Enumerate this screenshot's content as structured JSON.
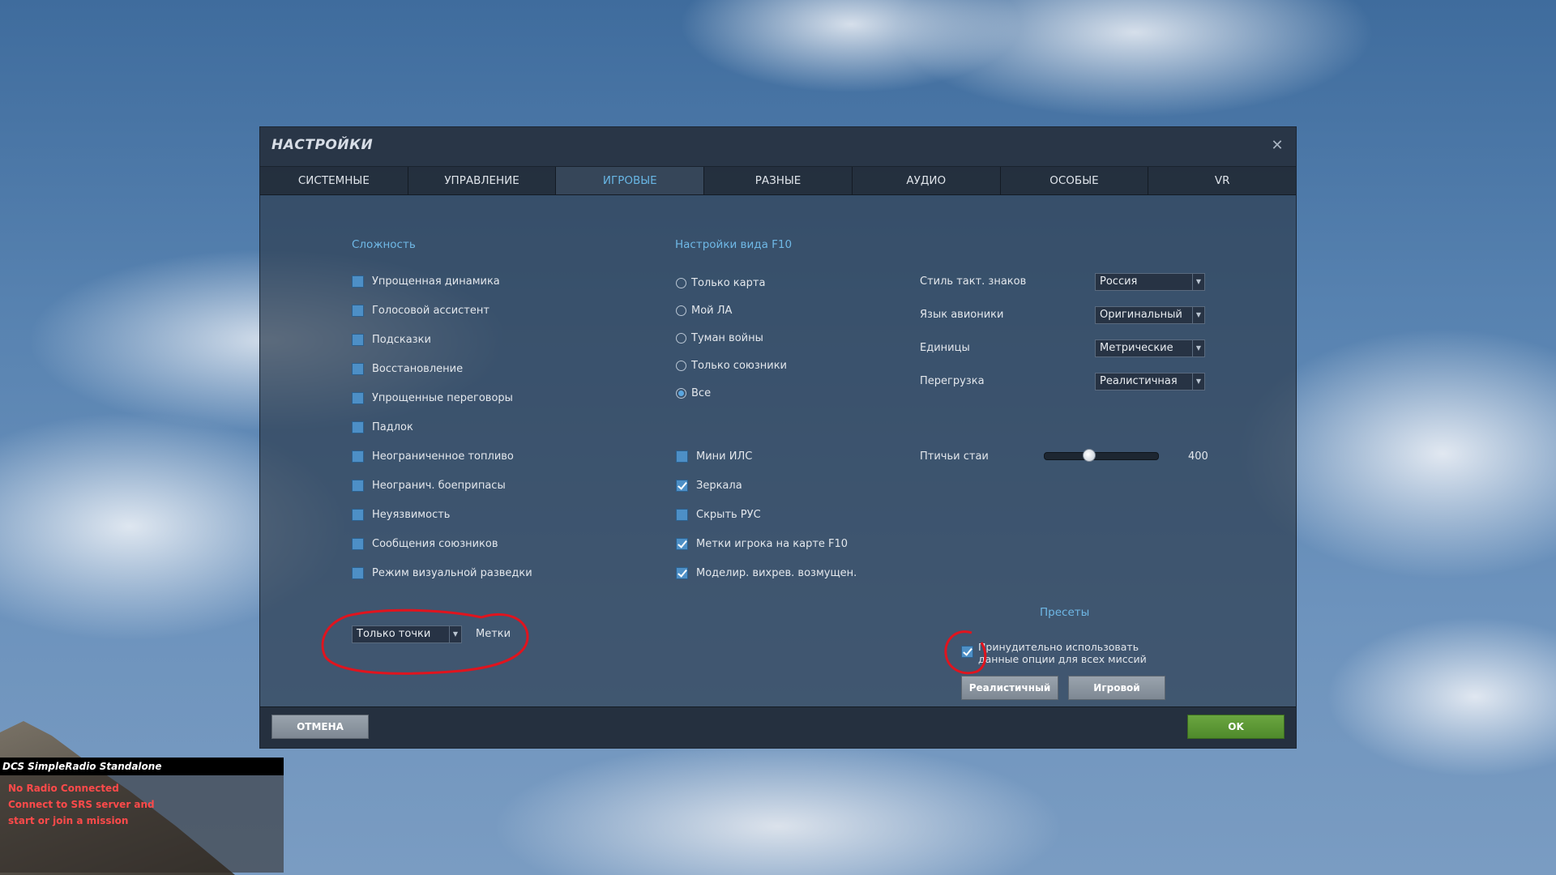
{
  "dialog": {
    "title": "НАСТРОЙКИ",
    "close_symbol": "✕"
  },
  "tabs": [
    {
      "label": "СИСТЕМНЫЕ"
    },
    {
      "label": "УПРАВЛЕНИЕ"
    },
    {
      "label": "ИГРОВЫЕ",
      "active": true
    },
    {
      "label": "РАЗНЫЕ"
    },
    {
      "label": "АУДИО"
    },
    {
      "label": "ОСОБЫЕ"
    },
    {
      "label": "VR"
    }
  ],
  "difficulty": {
    "title": "Сложность",
    "items": [
      {
        "label": "Упрощенная динамика",
        "checked": false
      },
      {
        "label": "Голосовой ассистент",
        "checked": false
      },
      {
        "label": "Подсказки",
        "checked": false
      },
      {
        "label": "Восстановление",
        "checked": false
      },
      {
        "label": "Упрощенные переговоры",
        "checked": false
      },
      {
        "label": "Падлок",
        "checked": false
      },
      {
        "label": "Неограниченное топливо",
        "checked": false
      },
      {
        "label": "Неогранич. боеприпасы",
        "checked": false
      },
      {
        "label": "Неуязвимость",
        "checked": false
      },
      {
        "label": "Сообщения союзников",
        "checked": false
      },
      {
        "label": "Режим визуальной разведки",
        "checked": false
      }
    ],
    "labels_dropdown": {
      "value": "Только точки"
    },
    "labels_label": "Метки"
  },
  "f10": {
    "title": "Настройки вида F10",
    "options": [
      {
        "label": "Только карта",
        "selected": false
      },
      {
        "label": "Мой ЛА",
        "selected": false
      },
      {
        "label": "Туман войны",
        "selected": false
      },
      {
        "label": "Только союзники",
        "selected": false
      },
      {
        "label": "Все",
        "selected": true
      }
    ],
    "checkboxes": [
      {
        "label": "Мини ИЛС",
        "checked": false
      },
      {
        "label": "Зеркала",
        "checked": true
      },
      {
        "label": "Скрыть РУС",
        "checked": false
      },
      {
        "label": "Метки игрока на карте F10",
        "checked": true
      },
      {
        "label": "Моделир. вихрев. возмущен.",
        "checked": true
      }
    ]
  },
  "settings": {
    "rows": [
      {
        "label": "Стиль такт. знаков",
        "value": "Россия"
      },
      {
        "label": "Язык авионики",
        "value": "Оригинальный"
      },
      {
        "label": "Единицы",
        "value": "Метрические"
      },
      {
        "label": "Перегрузка",
        "value": "Реалистичная"
      }
    ],
    "birds": {
      "label": "Птичьи стаи",
      "value": "400",
      "level": 0.4
    }
  },
  "presets": {
    "title": "Пресеты",
    "force_checked": true,
    "force_line1": "Принудительно использовать",
    "force_line2": "данные опции для всех миссий",
    "realistic_label": "Реалистичный",
    "game_label": "Игровой"
  },
  "footer": {
    "cancel_label": "ОТМЕНА",
    "ok_label": "OK"
  },
  "srs": {
    "title": "DCS SimpleRadio Standalone",
    "lines": [
      "No Radio Connected",
      "Connect to SRS server and",
      "start or join a mission"
    ],
    "color": "#ff4a4a"
  },
  "colors": {
    "accent": "#68b6e4",
    "checkbox": "#4d8fc6",
    "ok": "#5a9a34",
    "annotation": "#e0141e"
  }
}
